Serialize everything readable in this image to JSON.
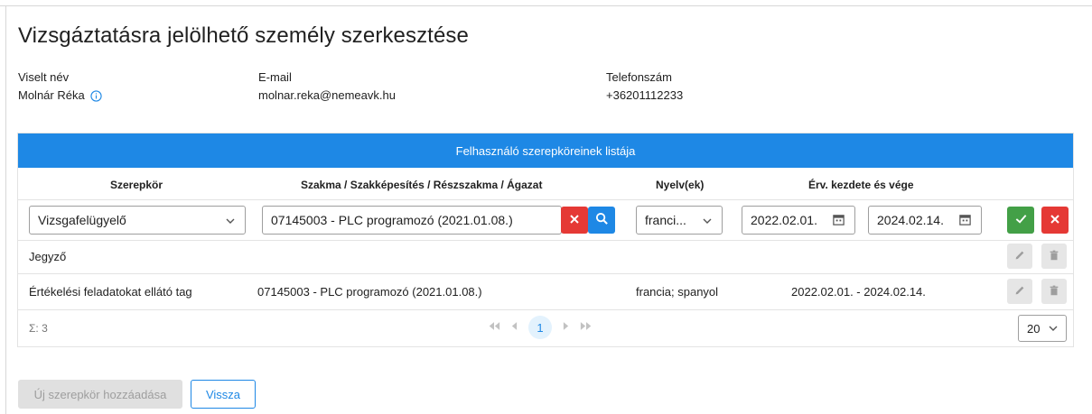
{
  "page": {
    "title": "Vizsgáztatásra jelölhető személy szerkesztése"
  },
  "person": {
    "name_label": "Viselt név",
    "name_value": "Molnár Réka",
    "email_label": "E-mail",
    "email_value": "molnar.reka@nemeavk.hu",
    "phone_label": "Telefonszám",
    "phone_value": "+36201112233"
  },
  "roles_table": {
    "header": "Felhasználó szerepköreinek listája",
    "columns": [
      "Szerepkör",
      "Szakma / Szakképesítés / Részszakma / Ágazat",
      "Nyelv(ek)",
      "Érv. kezdete és vége"
    ],
    "edit_row": {
      "role_select": "Vizsgafelügyelő",
      "profession_input": "07145003 - PLC programozó (2021.01.08.)",
      "language_select": "franci...",
      "date_start": "2022.02.01.",
      "date_end": "2024.02.14."
    },
    "rows": [
      {
        "role": "Jegyző",
        "profession": "",
        "languages": "",
        "validity": ""
      },
      {
        "role": "Értékelési feladatokat ellátó tag",
        "profession": "07145003 - PLC programozó (2021.01.08.)",
        "languages": "francia; spanyol",
        "validity": "2022.02.01. - 2024.02.14."
      }
    ],
    "footer": {
      "total": "Σ: 3",
      "current_page": "1",
      "page_size": "20"
    }
  },
  "actions": {
    "add_role": "Új szerepkör hozzáadása",
    "back": "Vissza"
  },
  "colors": {
    "primary": "#1e88e5",
    "danger": "#e53935",
    "success": "#43a047",
    "disabled": "#e0e0e0"
  }
}
